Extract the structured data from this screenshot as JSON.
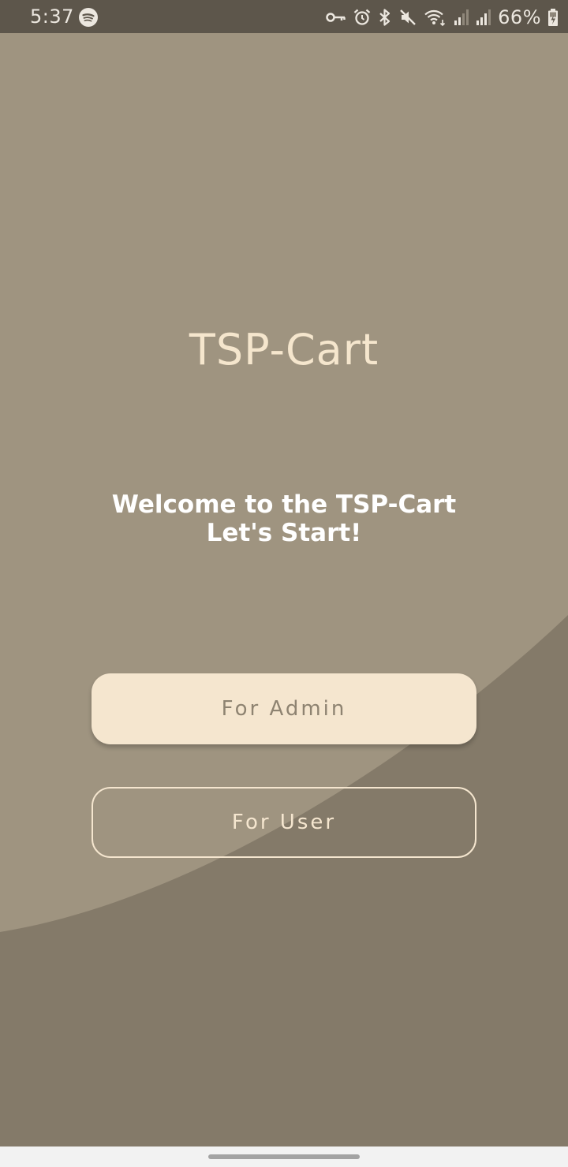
{
  "status_bar": {
    "time": "5:37",
    "battery_percent": "66%",
    "icons": [
      "spotify-icon",
      "vpn-key-icon",
      "alarm-icon",
      "bluetooth-icon",
      "mute-icon",
      "wifi-icon",
      "signal-icon",
      "signal-icon",
      "battery-icon"
    ]
  },
  "app": {
    "title": "TSP-Cart",
    "welcome_line1": "Welcome to the TSP-Cart",
    "welcome_line2": "Let's Start!",
    "admin_button_label": "For Admin",
    "user_button_label": "For User"
  },
  "colors": {
    "background_light": "#9f9480",
    "background_dark": "#847a69",
    "accent": "#f5e6cf",
    "status_bar": "#5d564b"
  }
}
